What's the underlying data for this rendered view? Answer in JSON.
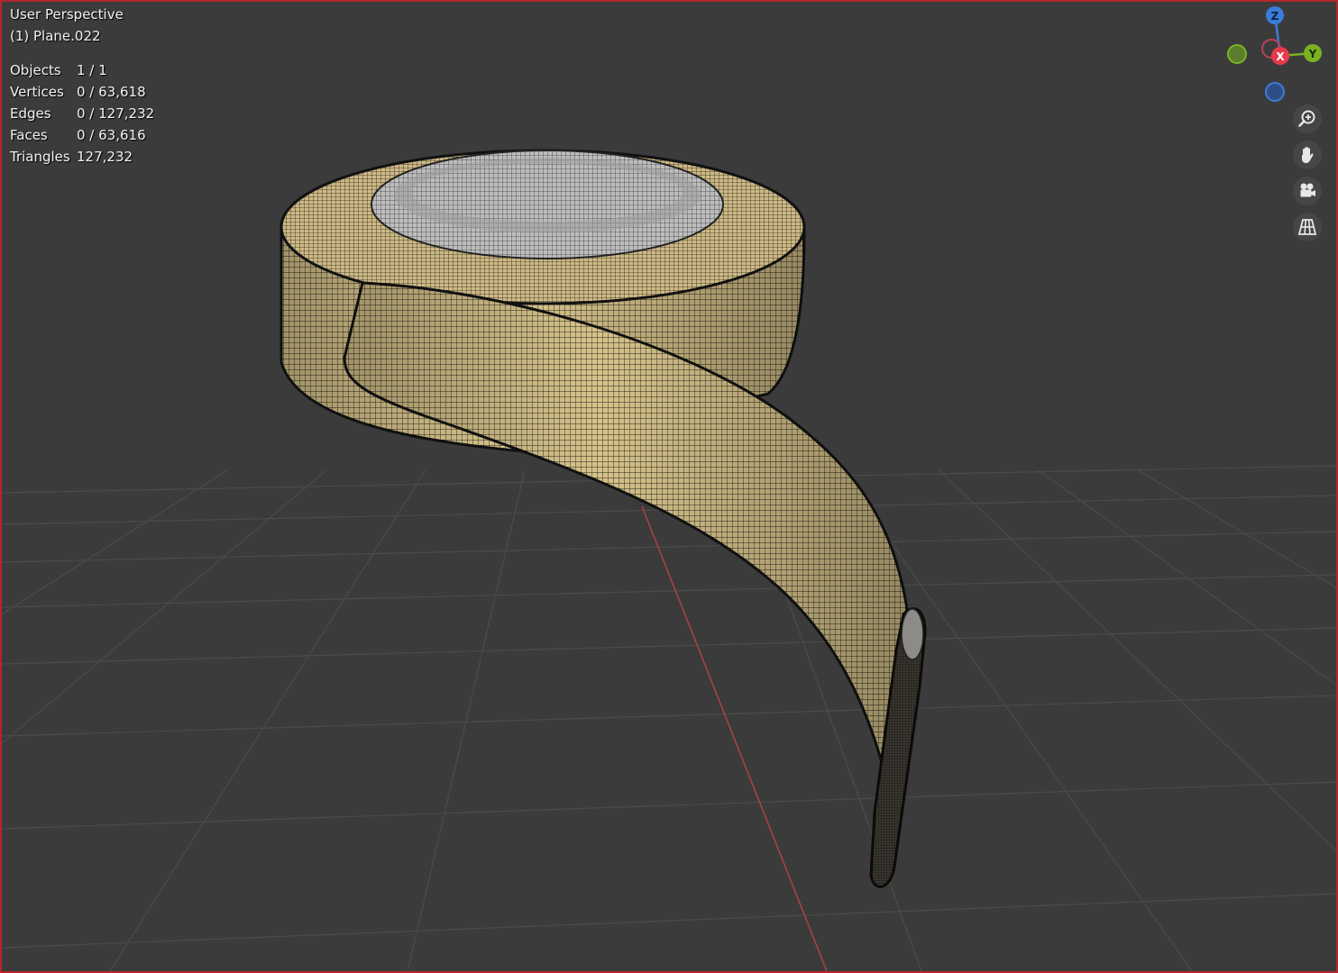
{
  "viewport": {
    "view_name": "User Perspective",
    "active_object": "(1) Plane.022",
    "border_color": "#b3262b"
  },
  "stats": [
    {
      "label": "Objects",
      "value": "1 / 1"
    },
    {
      "label": "Vertices",
      "value": "0 / 63,618"
    },
    {
      "label": "Edges",
      "value": "0 / 127,232"
    },
    {
      "label": "Faces",
      "value": "0 / 63,616"
    },
    {
      "label": "Triangles",
      "value": "127,232"
    }
  ],
  "gizmo": {
    "x_label": "X",
    "y_label": "Y",
    "z_label": "Z",
    "x_color": "#e63a4c",
    "y_color": "#7ab322",
    "z_color": "#3b7dd8"
  },
  "nav_tools": [
    {
      "name": "zoom-icon"
    },
    {
      "name": "hand-pan-icon"
    },
    {
      "name": "camera-icon"
    },
    {
      "name": "perspective-grid-icon"
    }
  ],
  "colors": {
    "tape_surface": "#d8c48c",
    "wire": "#1c1a14",
    "inner_core": "#b8b8b8",
    "floor_grid": "#4a4a4a",
    "x_axis_line": "#a8414a"
  }
}
